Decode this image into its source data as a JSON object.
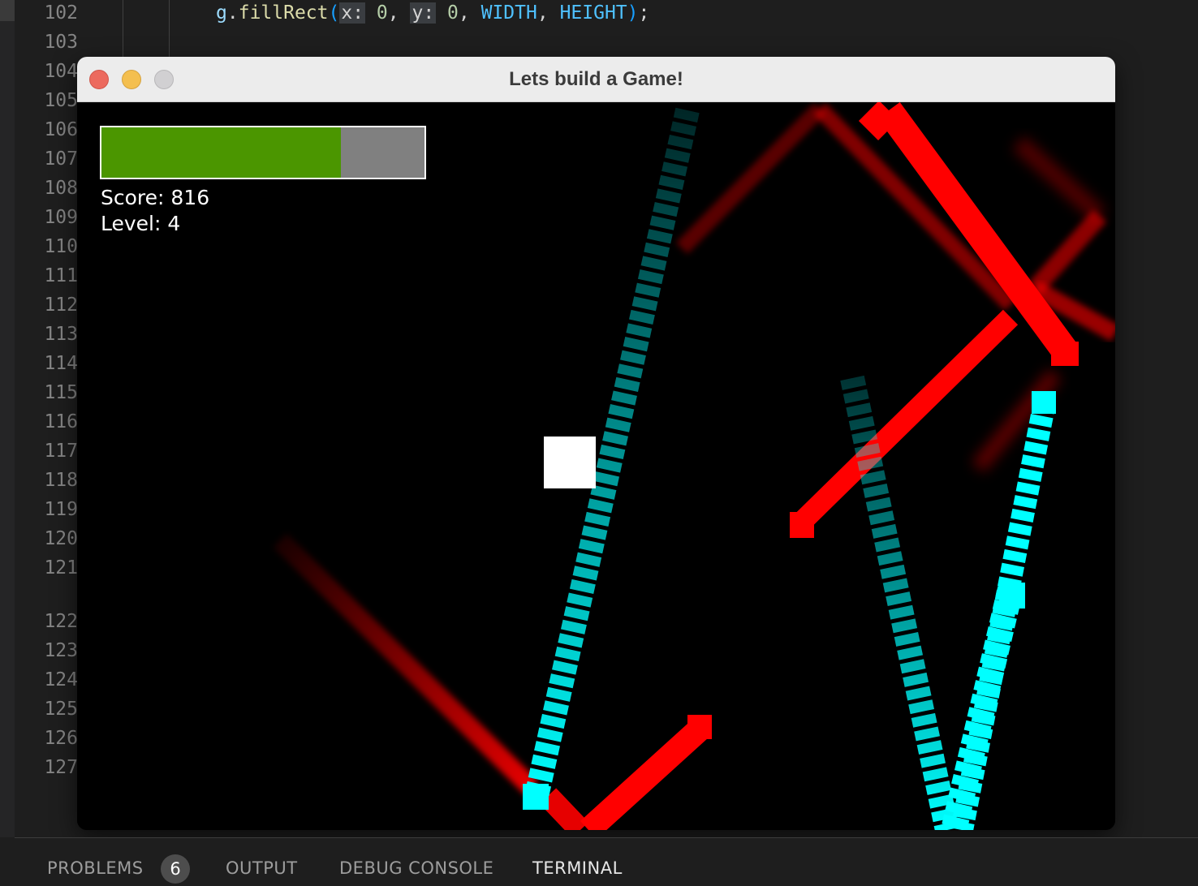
{
  "editor": {
    "line_numbers": [
      "102",
      "103",
      "104",
      "105",
      "106",
      "107",
      "108",
      "109",
      "110",
      "111",
      "112",
      "113",
      "114",
      "115",
      "116",
      "117",
      "118",
      "119",
      "120",
      "121",
      "122",
      "123",
      "124",
      "125",
      "126",
      "127"
    ],
    "code_line_102": {
      "receiver": "g",
      "dot": ".",
      "method": "fillRect",
      "open_paren": "(",
      "hint_x": "x:",
      "arg_x": "0",
      "sep1": ", ",
      "hint_y": "y:",
      "arg_y": "0",
      "sep2": ", ",
      "arg_width": "WIDTH",
      "sep3": ", ",
      "arg_height": "HEIGHT",
      "close_paren": ")",
      "semicolon": ";"
    }
  },
  "game_window": {
    "title": "Lets build a Game!",
    "health": {
      "fraction": 0.74,
      "fill_color": "#4b9600",
      "empty_color": "#808080"
    },
    "score_text": "Score: 816",
    "level_text": "Level: 4",
    "colors": {
      "player": "#ffffff",
      "enemy_fast": "#ff0000",
      "enemy_basic": "#00ffff",
      "background": "#000000"
    }
  },
  "panel": {
    "tabs": [
      {
        "label": "PROBLEMS",
        "badge": "6"
      },
      {
        "label": "OUTPUT"
      },
      {
        "label": "DEBUG CONSOLE"
      },
      {
        "label": "TERMINAL",
        "active": true
      }
    ]
  }
}
